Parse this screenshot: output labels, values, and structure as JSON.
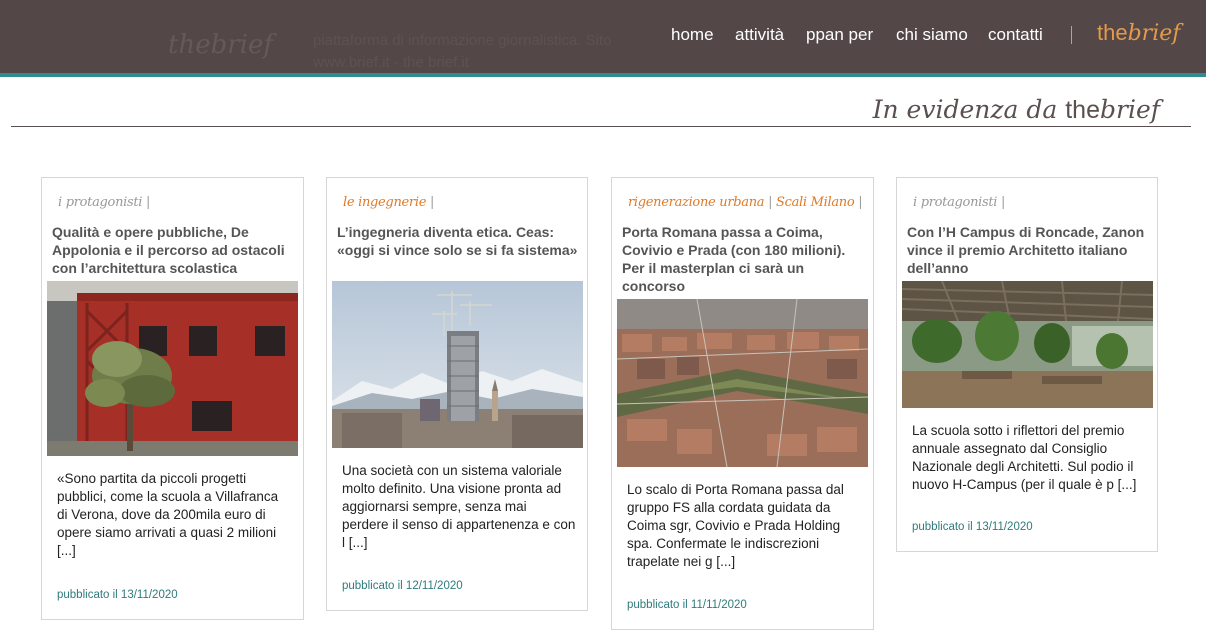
{
  "header": {
    "ghost_logo": "thebrief",
    "ghost_text": "piattaforma di informazione giornalistica. Sito www.brief.it - the brief.it",
    "nav": [
      {
        "label": "home"
      },
      {
        "label": "attività"
      },
      {
        "label": "ppan per"
      },
      {
        "label": "chi siamo"
      },
      {
        "label": "contatti"
      }
    ],
    "brand": {
      "part1": "the",
      "part2": "brief"
    }
  },
  "section": {
    "prefix": "In evidenza da ",
    "brand1": "the",
    "brand2": "brief"
  },
  "colors": {
    "header_bg": "#534747",
    "accent_teal": "#2f8c8f",
    "brand_orange": "#e39a4a",
    "category_orange": "#e07a26",
    "date_teal": "#2f7b7c"
  },
  "cards": [
    {
      "categories": [
        "i protagonisti"
      ],
      "category_color": "grey",
      "title": "Qualità e opere pubbliche, De Appolonia e il percorso ad ostacoli con l’architettura scolastica",
      "image": "red-school-building-with-olive-tree",
      "excerpt": "«Sono partita da piccoli progetti pubblici, come la scuola a Villafranca di Verona, dove da 200mila euro di opere siamo arrivati a quasi 2 milioni [...]",
      "published": "pubblicato il 13/11/2020"
    },
    {
      "categories": [
        "le ingegnerie"
      ],
      "category_color": "orange",
      "title": "L’ingegneria diventa etica. Ceas: «oggi si vince solo se si fa sistema»",
      "image": "skyscraper-under-construction-with-cranes",
      "excerpt": "Una società con un sistema valoriale molto definito. Una visione pronta ad aggiornarsi sempre, senza mai perdere il senso di appartenenza e con l [...]",
      "published": "pubblicato il 12/11/2020"
    },
    {
      "categories": [
        "rigenerazione urbana",
        "Scali Milano"
      ],
      "category_color": "orange",
      "title": "Porta Romana passa a Coima, Covivio e Prada (con 180 milioni). Per il masterplan ci sarà un concorso",
      "image": "aerial-view-porta-romana-rail-yard",
      "excerpt": "Lo scalo di Porta Romana passa dal gruppo FS alla cordata guidata da Coima sgr, Covivio e Prada Holding spa. Confermate le indiscrezioni trapelate nei g [...]",
      "published": "pubblicato il 11/11/2020"
    },
    {
      "categories": [
        "i protagonisti"
      ],
      "category_color": "grey",
      "title": "Con l’H Campus di Roncade, Zanon vince il premio Architetto italiano dell’anno",
      "image": "interior-campus-with-plants",
      "excerpt": "La scuola sotto i riflettori del premio annuale assegnato dal Consiglio Nazionale degli Architetti. Sul podio il nuovo H-Campus (per il quale è p [...]",
      "published": "pubblicato il 13/11/2020"
    }
  ]
}
